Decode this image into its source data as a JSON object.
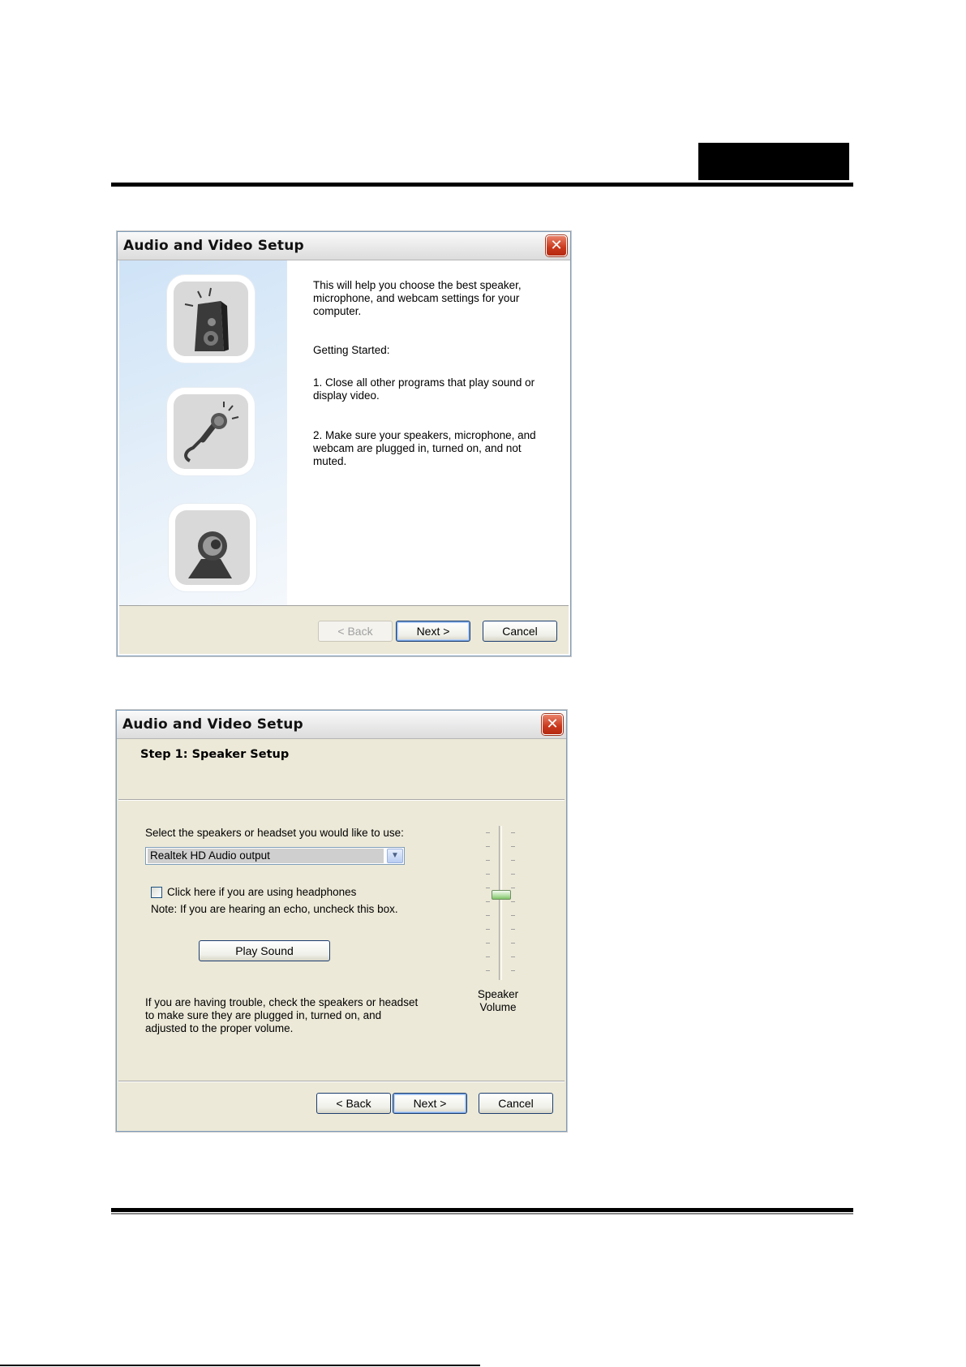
{
  "dialog1": {
    "title": "Audio and Video Setup",
    "intro": "This will help you choose the best speaker, microphone, and webcam settings for your computer.",
    "getting_started": "Getting Started:",
    "step1": "1. Close all other programs that play sound or display video.",
    "step2": "2. Make sure your speakers, microphone, and webcam are plugged in, turned on, and not muted.",
    "icons": [
      "speaker-icon",
      "microphone-icon",
      "webcam-icon"
    ],
    "buttons": {
      "back": "< Back",
      "next": "Next >",
      "cancel": "Cancel"
    }
  },
  "dialog2": {
    "title": "Audio and Video Setup",
    "step_title": "Step 1: Speaker Setup",
    "select_label": "Select the speakers or headset you would like to use:",
    "selected_device": "Realtek HD Audio output",
    "headphones_checkbox_label": "Click here if you are using headphones",
    "headphones_checked": false,
    "note": "Note: If you are hearing an echo, uncheck this box.",
    "play_sound": "Play Sound",
    "trouble_text": "If you are having trouble, check the speakers or headset to make sure they are plugged in, turned on, and adjusted to the proper volume.",
    "volume_label_line1": "Speaker",
    "volume_label_line2": "Volume",
    "volume_level_fraction": 0.55,
    "buttons": {
      "back": "< Back",
      "next": "Next >",
      "cancel": "Cancel"
    }
  },
  "colors": {
    "dialog_face": "#ece9d8",
    "close_button": "#c9381c",
    "panel_gradient_start": "#cfe3f7"
  }
}
